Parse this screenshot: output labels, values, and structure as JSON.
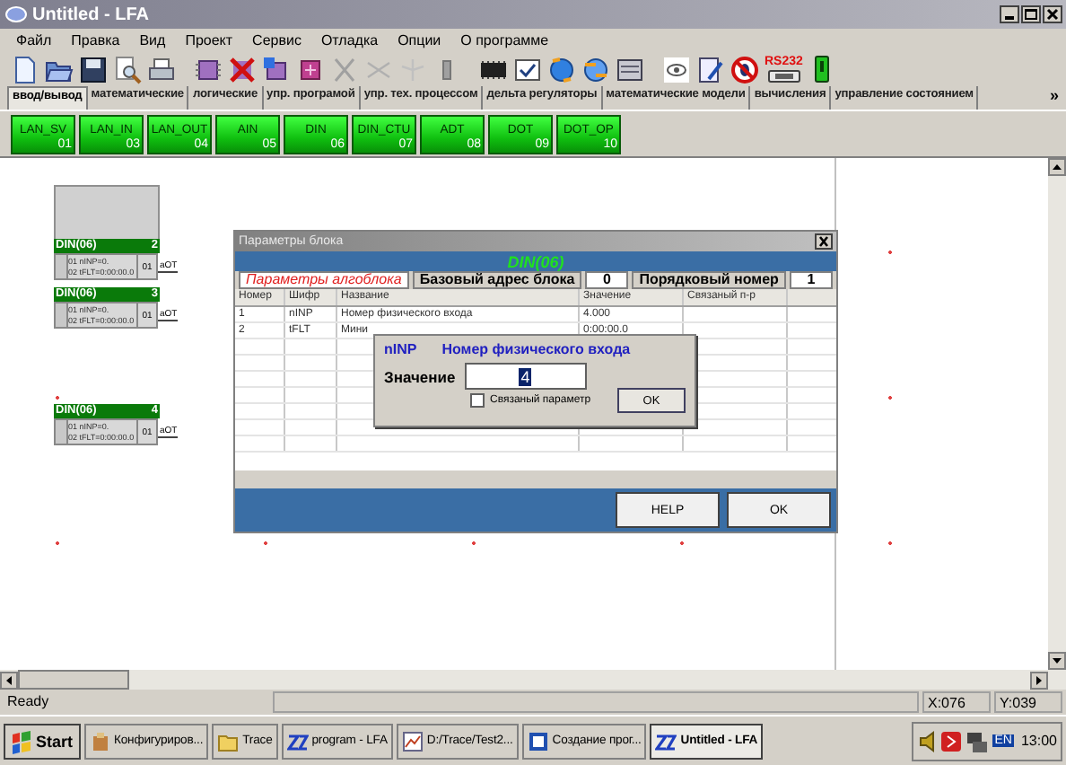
{
  "window": {
    "title": "Untitled - LFA"
  },
  "menu": [
    "Файл",
    "Правка",
    "Вид",
    "Проект",
    "Сервис",
    "Отладка",
    "Опции",
    "О программе"
  ],
  "toolbar": {
    "port_label": "RS232"
  },
  "tabs": [
    {
      "label": "ввод/вывод",
      "selected": true
    },
    {
      "label": "математические",
      "selected": false
    },
    {
      "label": "логические",
      "selected": false
    },
    {
      "label": "упр. програмой",
      "selected": false
    },
    {
      "label": "упр. тех. процессом",
      "selected": false
    },
    {
      "label": "дельта регуляторы",
      "selected": false
    },
    {
      "label": "математические модели",
      "selected": false
    },
    {
      "label": "вычисления",
      "selected": false
    },
    {
      "label": "управление состоянием",
      "selected": false
    }
  ],
  "tabs_more": "»",
  "palette": [
    {
      "name": "LAN_SV",
      "number": "01"
    },
    {
      "name": "LAN_IN",
      "number": "03"
    },
    {
      "name": "LAN_OUT",
      "number": "04"
    },
    {
      "name": "AIN",
      "number": "05"
    },
    {
      "name": "DIN",
      "number": "06"
    },
    {
      "name": "DIN_CTU",
      "number": "07"
    },
    {
      "name": "ADT",
      "number": "08"
    },
    {
      "name": "DOT",
      "number": "09"
    },
    {
      "name": "DOT_OP",
      "number": "10"
    }
  ],
  "canvas": {
    "blocks": [
      {
        "kind": "empty"
      },
      {
        "kind": "din",
        "title": "DIN(06)",
        "number": "2",
        "params": [
          "01 nINP=0.",
          "02 tFLT=0:00:00.0"
        ],
        "output": "01",
        "output_label": "aOT"
      },
      {
        "kind": "din",
        "title": "DIN(06)",
        "number": "3",
        "params": [
          "01 nINP=0.",
          "02 tFLT=0:00:00.0"
        ],
        "output": "01",
        "output_label": "aOT"
      },
      {
        "kind": "din",
        "title": "DIN(06)",
        "number": "4",
        "params": [
          "01 nINP=0.",
          "02 tFLT=0:00:00.0"
        ],
        "output": "01",
        "output_label": "aOT"
      }
    ]
  },
  "dialog": {
    "title": "Параметры блока",
    "block_name": "DIN(06)",
    "section_label": "Параметры алгоблока",
    "base_address_label": "Базовый адрес блока",
    "base_address": "0",
    "order_label": "Порядковый номер",
    "order": "1",
    "table": {
      "columns": [
        "Номер",
        "Шифр",
        "Название",
        "Значение",
        "Связаный п-р"
      ],
      "rows": [
        [
          "1",
          "nINP",
          "Номер физического входа",
          "4.000"
        ],
        [
          "2",
          "tFLT",
          "Мини",
          "0:00:00.0"
        ]
      ]
    },
    "buttons": [
      "HELP",
      "OK"
    ]
  },
  "popup": {
    "code": "nINP",
    "title": "Номер физического входа",
    "value_label": "Значение",
    "value": "4",
    "linked": {
      "label": "Связаный параметр",
      "checked": false
    },
    "button": "OK"
  },
  "status_bar": {
    "text": "Ready",
    "x": "X:076",
    "y": "Y:039"
  },
  "taskbar": {
    "start": "Start",
    "items": [
      {
        "label": "Конфигуриров...",
        "selected": false
      },
      {
        "label": "Trace",
        "selected": false
      },
      {
        "label": "program - LFA",
        "selected": false
      },
      {
        "label": "D:/Trace/Test2...",
        "selected": false
      },
      {
        "label": "Создание прог...",
        "selected": false
      },
      {
        "label": "Untitled - LFA",
        "selected": true
      }
    ],
    "language": "EN",
    "clock": "13:00"
  }
}
